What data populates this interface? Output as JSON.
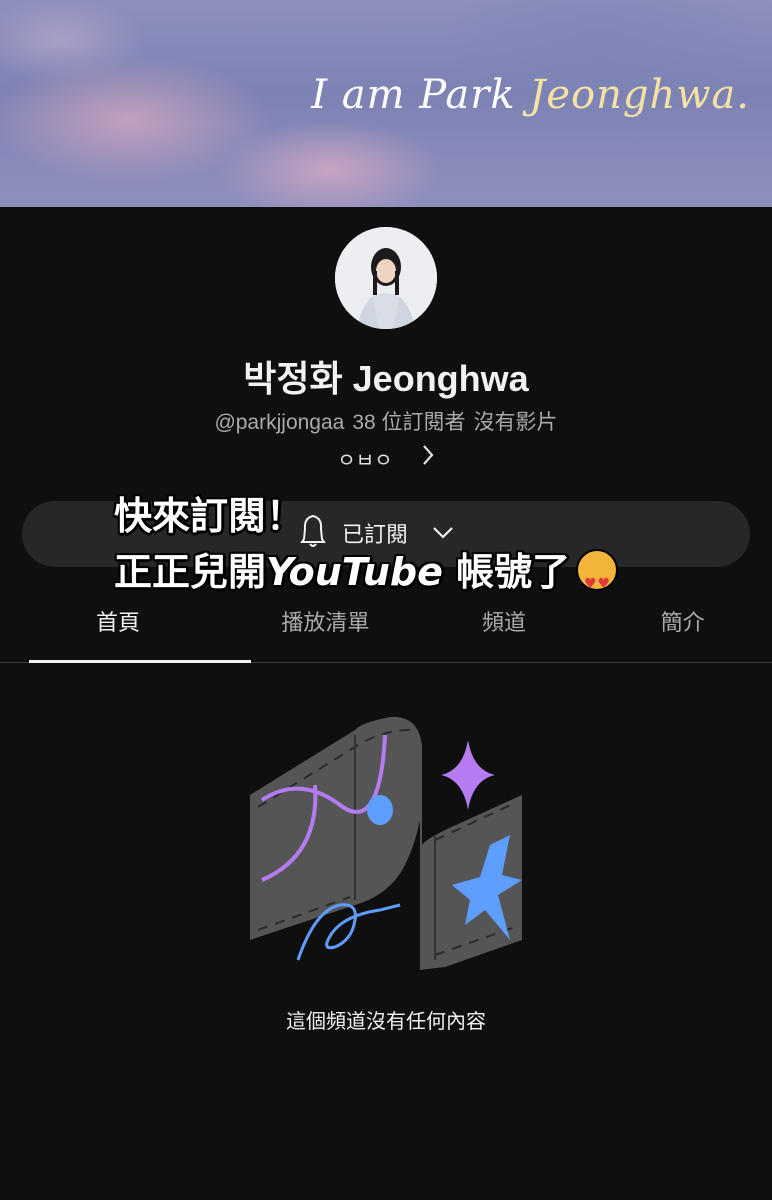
{
  "banner": {
    "text_part1": "I am Park ",
    "text_part2": "Jeonghwa."
  },
  "channel": {
    "name": "박정화 Jeonghwa",
    "handle": "@parkjjongaa",
    "subscribers": "38 位訂閱者",
    "videos": "沒有影片",
    "more_text": "ㅇㅂㅇ"
  },
  "subscribe": {
    "label": "已訂閱"
  },
  "overlay": {
    "line1": "快來訂閱！",
    "line2_prefix": "正正兒開",
    "line2_brand": "YouTube",
    "line2_suffix": " 帳號了"
  },
  "tabs": [
    {
      "label": "首頁",
      "active": true
    },
    {
      "label": "播放清單",
      "active": false
    },
    {
      "label": "頻道",
      "active": false
    },
    {
      "label": "簡介",
      "active": false
    }
  ],
  "empty_state": {
    "message": "這個頻道沒有任何內容"
  },
  "colors": {
    "background": "#0f0f0f",
    "pill": "#272727",
    "accent_purple": "#b57cf2",
    "accent_blue": "#5e9eff"
  }
}
